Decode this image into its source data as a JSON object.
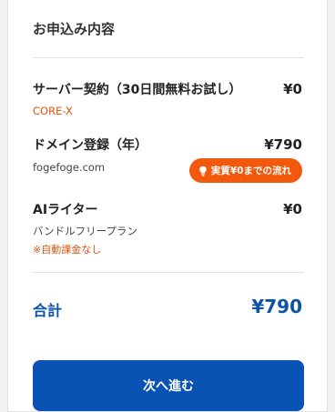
{
  "section_title": "お申込み内容",
  "items": [
    {
      "label": "サーバー契約（30日間無料お試し）",
      "price": "¥0",
      "sub": "CORE-X"
    },
    {
      "label": "ドメイン登録（年）",
      "price": "¥790",
      "sub": "fogefoge.com",
      "badge": "実質¥0までの流れ"
    },
    {
      "label": "AIライター",
      "price": "¥0",
      "sub": "バンドルフリープラン",
      "note": "※自動課金なし"
    }
  ],
  "total": {
    "label": "合計",
    "price": "¥790"
  },
  "next_button": "次へ進む",
  "colors": {
    "accent_blue": "#0a53b5",
    "orange": "#f2590c",
    "note_orange": "#e0530c"
  },
  "icons": {
    "badge_icon": "lightbulb-icon"
  }
}
